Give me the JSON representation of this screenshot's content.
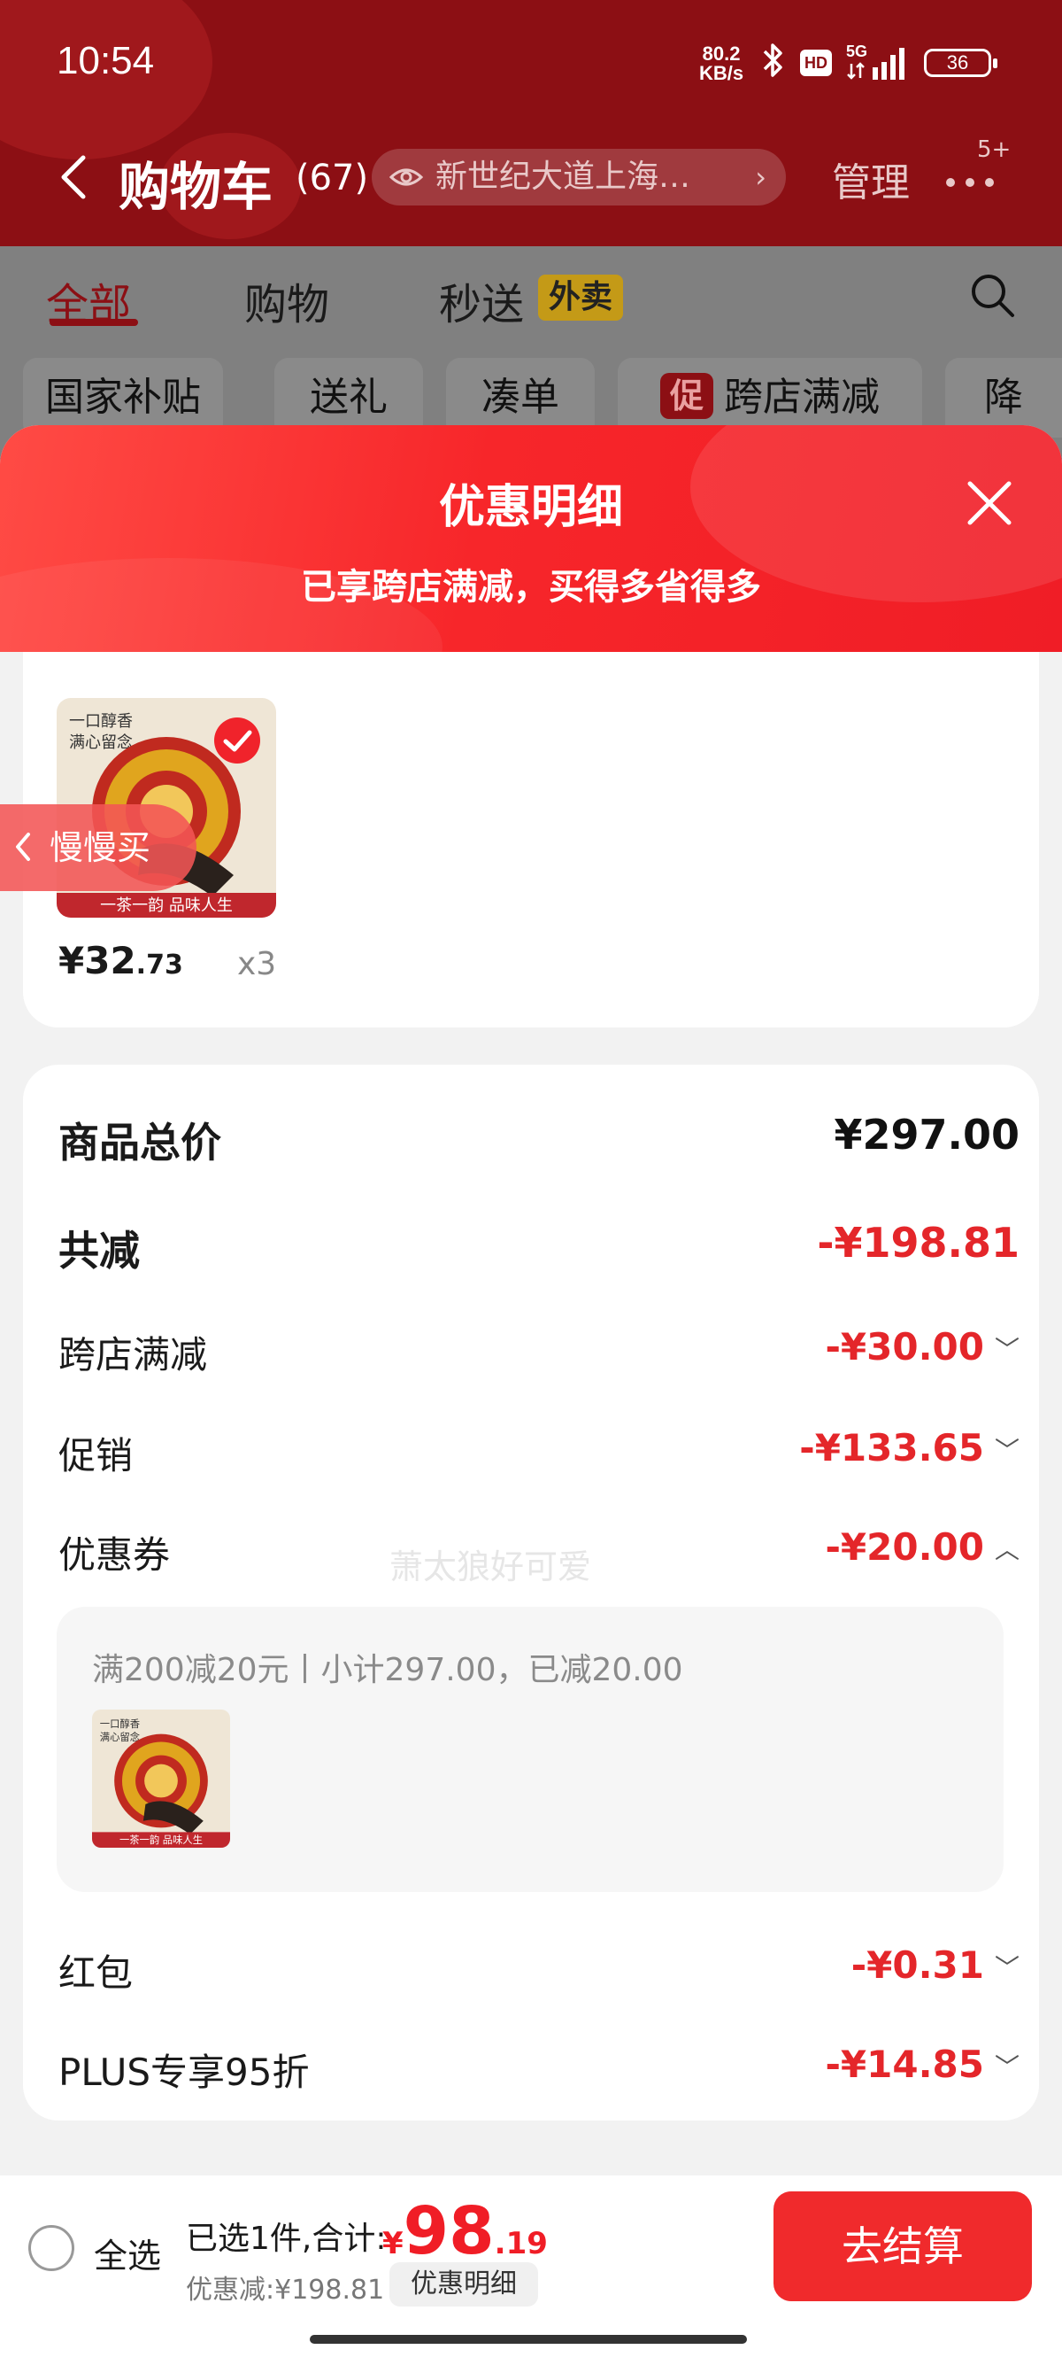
{
  "status_bar": {
    "time": "10:54",
    "net_speed_value": "80.2",
    "net_speed_unit": "KB/s",
    "hd": "HD",
    "network": "5G",
    "battery": "36"
  },
  "nav": {
    "title": "购物车",
    "count": "(67)",
    "address": "新世纪大道上海…",
    "manage": "管理",
    "more_badge": "5+"
  },
  "tabs": [
    {
      "label": "全部",
      "active": true
    },
    {
      "label": "购物"
    },
    {
      "label": "秒送"
    }
  ],
  "waimai_badge": "外卖",
  "chips": [
    "国家补贴",
    "送礼",
    "凑单",
    "跨店满减",
    "降"
  ],
  "promo_chip_icon": "促",
  "sheet": {
    "title": "优惠明细",
    "subtitle": "已享跨店满减，买得多省得多"
  },
  "product": {
    "price_int": "¥32",
    "price_dec": ".73",
    "qty": "x3",
    "img_text_top1": "一口醇香",
    "img_text_top2": "满心留念",
    "img_text_bottom": "一茶一韵 品味人生"
  },
  "slow_buy": "慢慢买",
  "breakdown": {
    "total_label": "商品总价",
    "total_value": "¥297.00",
    "reduce_label": "共减",
    "reduce_value": "-¥198.81",
    "items": [
      {
        "label": "跨店满减",
        "value": "-¥30.00",
        "expanded": false
      },
      {
        "label": "促销",
        "value": "-¥133.65",
        "expanded": false
      },
      {
        "label": "优惠券",
        "value": "-¥20.00",
        "expanded": true
      },
      {
        "label": "红包",
        "value": "-¥0.31",
        "expanded": false
      },
      {
        "label": "PLUS专享95折",
        "value": "-¥14.85",
        "expanded": false
      }
    ],
    "coupon_detail": "满200减20元丨小计297.00，已减20.00"
  },
  "watermark": "萧太狼好可爱",
  "bottom_bar": {
    "select_all": "全选",
    "selected_info": "已选1件,合计:",
    "total_currency": "¥",
    "total_int": "98",
    "total_dec": ".19",
    "saved": "优惠减:¥198.81",
    "detail_button": "优惠明细",
    "checkout": "去结算"
  },
  "colors": {
    "accent_red": "#f01d26",
    "topbar_dark_red": "#8c0f14",
    "discount_red": "#e4262a"
  },
  "icons": [
    "back-icon",
    "eye-icon",
    "more-icon",
    "search-icon",
    "close-icon",
    "chevron-left-icon",
    "chevron-down-icon",
    "chevron-up-icon",
    "checkmark-icon"
  ]
}
